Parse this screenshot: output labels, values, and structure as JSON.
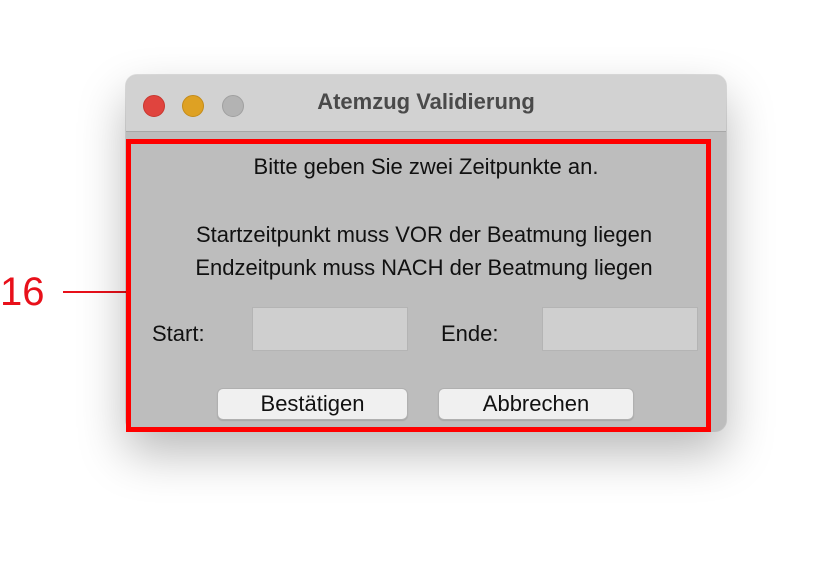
{
  "annotation": {
    "number": "16",
    "color": "#ff0000"
  },
  "window": {
    "title": "Atemzug Validierung",
    "controls": {
      "close": "close-button",
      "minimize": "minimize-button",
      "zoom": "zoom-button"
    },
    "colors": {
      "close": "#e0443e",
      "minimize": "#dea123",
      "zoom_disabled": "#b3b3b3",
      "background": "#bdbdbd"
    }
  },
  "dialog": {
    "instruction": "Bitte geben Sie zwei Zeitpunkte an.",
    "rule_start": "Startzeitpunkt muss VOR der Beatmung liegen",
    "rule_end": "Endzeitpunk muss NACH der Beatmung liegen",
    "start_label": "Start:",
    "start_value": "",
    "end_label": "Ende:",
    "end_value": "",
    "confirm_label": "Bestätigen",
    "cancel_label": "Abbrechen"
  }
}
